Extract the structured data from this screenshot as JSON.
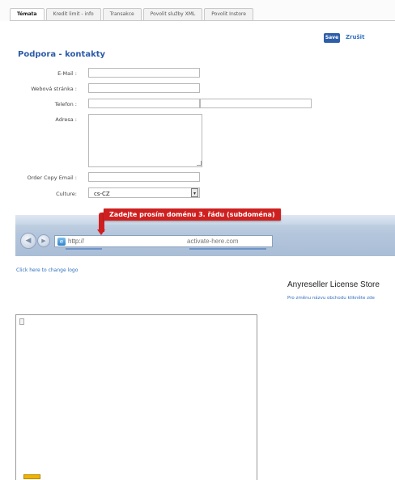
{
  "tabs": [
    {
      "label": "Témata",
      "active": true
    },
    {
      "label": "Kredit limit - info",
      "active": false
    },
    {
      "label": "Transakce",
      "active": false
    },
    {
      "label": "Povolit služby XML",
      "active": false
    },
    {
      "label": "Povolit Instore",
      "active": false
    }
  ],
  "toolbar": {
    "save_label": "Save",
    "cancel_label": "Zrušit"
  },
  "section_title": "Podpora - kontakty",
  "form": {
    "email_label": "E-Mail :",
    "website_label": "Webová stránka :",
    "phone_label": "Telefon :",
    "address_label": "Adresa :",
    "order_copy_label": "Order Copy Email :",
    "culture_label": "Culture:",
    "culture_value": "cs-CZ"
  },
  "browser_preview": {
    "callout": "Zadejte prosím doménu 3. řádu (subdoména)",
    "url_prefix": "http://",
    "url_domain": "activate-here.com"
  },
  "logo_link": "Click here to change logo",
  "store": {
    "title": "Anyreseller License Store",
    "subtitle": "Pro změnu názvu obchodu klikněte zde"
  },
  "colors": {
    "accent": "#2b5ba8",
    "callout": "#cf2020",
    "save": "#2f5ea9"
  }
}
